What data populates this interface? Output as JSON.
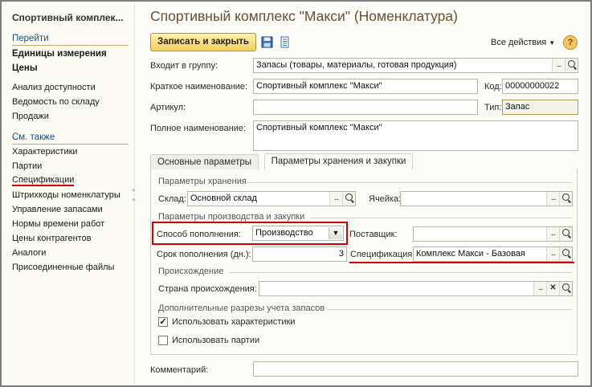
{
  "left_panel": {
    "title": "Спортивный комплек...",
    "goto_header": "Перейти",
    "goto_bold": [
      "Единицы измерения",
      "Цены"
    ],
    "goto_items": [
      "Анализ доступности",
      "Ведомость по складу",
      "Продажи"
    ],
    "see_also_header": "См. также",
    "see_also_items": [
      "Характеристики",
      "Партии",
      "Спецификации",
      "Штрихкоды номенклатуры",
      "Управление запасами",
      "Нормы времени работ",
      "Цены контрагентов",
      "Аналоги",
      "Присоединенные файлы"
    ]
  },
  "header": {
    "title": "Спортивный комплекс \"Макси\" (Номенклатура)",
    "save_close": "Записать и закрыть",
    "all_actions": "Все действия",
    "help": "?"
  },
  "form": {
    "group_label": "Входит в группу:",
    "group_value": "Запасы (товары, материалы, готовая продукция)",
    "short_name_label": "Краткое наименование:",
    "short_name_value": "Спортивный комплекс \"Макси\"",
    "code_label": "Код:",
    "code_value": "00000000022",
    "article_label": "Артикул:",
    "article_value": "",
    "type_label": "Тип:",
    "type_value": "Запас",
    "full_name_label": "Полное наименование:",
    "full_name_value": "Спортивный комплекс \"Макси\""
  },
  "tabs": [
    "Основные параметры",
    "Параметры хранения и закупки"
  ],
  "storage": {
    "header": "Параметры хранения",
    "warehouse_label": "Склад:",
    "warehouse_value": "Основной склад",
    "cell_label": "Ячейка:",
    "cell_value": ""
  },
  "production": {
    "header": "Параметры производства и закупки",
    "replenishment_label": "Способ пополнения:",
    "replenishment_value": "Производство",
    "supplier_label": "Поставщик:",
    "supplier_value": "",
    "term_label": "Срок пополнения (дн.):",
    "term_value": "3",
    "spec_label": "Спецификация:",
    "spec_value": "Комплекс Макси - Базовая"
  },
  "origin": {
    "header": "Происхождение",
    "country_label": "Страна происхождения:",
    "country_value": ""
  },
  "extra": {
    "header": "Дополнительные разрезы учета запасов",
    "use_characteristics": "Использовать характеристики",
    "use_characteristics_checked": true,
    "use_batches": "Использовать партии",
    "use_batches_checked": false
  },
  "comment": {
    "label": "Комментарий:",
    "value": ""
  },
  "colors": {
    "highlight": "#d40000",
    "title": "#6b4f2e",
    "section": "#1f4e79"
  }
}
